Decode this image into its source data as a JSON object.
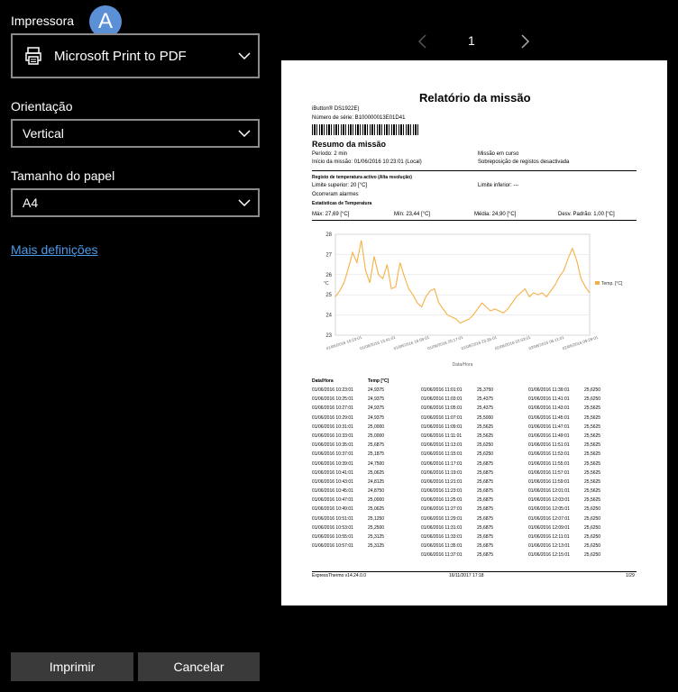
{
  "left": {
    "printer_label": "Impressora",
    "printer_value": "Microsoft Print to PDF",
    "badge": "A",
    "orientation_label": "Orientação",
    "orientation_value": "Vertical",
    "paper_label": "Tamanho do papel",
    "paper_value": "A4",
    "more_settings": "Mais definições",
    "print_button": "Imprimir",
    "cancel_button": "Cancelar"
  },
  "pager": {
    "page": "1"
  },
  "report": {
    "title": "Relatório da missão",
    "device": "iButton® DS1922E)",
    "serial": "Número de série: B100000013E01D41",
    "summary_title": "Resumo da missão",
    "period": "Período: 2 min",
    "start": "Início da missão: 01/06/2016 10:23:01 (Local)",
    "status": "Missão em curso",
    "overwrite": "Sobreposição de registos desactivada",
    "temp_reg": "Registo de temperatura activo (Alta resolução)",
    "upper_limit": "Limite superior: 20 [°C]",
    "lower_limit": "Limite inferior: ---",
    "alarms": "Ocorreram alarmes",
    "stats_title": "Estatísticas de Temperatura",
    "max": "Máx: 27,69 [°C]",
    "min": "Mín: 23,44 [°C]",
    "avg": "Média: 24,90 [°C]",
    "std": "Desv. Padrão: 1,00 [°C]",
    "table_headers": {
      "date": "Data/Hora",
      "temp": "Temp [°C]"
    },
    "footer_left": "ExpressThermo v14.24.0.0",
    "footer_mid": "16/11/2017    17:18",
    "footer_right": "1/29"
  },
  "chart_data": {
    "type": "line",
    "ylabel": "°C",
    "xlabel": "Data/Hora",
    "ylim": [
      23,
      28
    ],
    "yticks": [
      23,
      24,
      25,
      26,
      27,
      28
    ],
    "grid": true,
    "legend": "right",
    "series": [
      {
        "name": "Temp. [°C]",
        "color": "#f5b042",
        "values": [
          24.9,
          25.2,
          25.6,
          26.3,
          27.1,
          26.6,
          27.7,
          26.2,
          25.6,
          26.9,
          26.0,
          25.8,
          26.5,
          25.3,
          25.4,
          26.6,
          25.9,
          25.3,
          25.0,
          24.6,
          24.4,
          24.9,
          25.2,
          25.3,
          24.6,
          24.3,
          24.0,
          23.9,
          23.8,
          23.6,
          23.7,
          23.8,
          24.0,
          24.3,
          24.6,
          24.4,
          24.2,
          24.3,
          24.2,
          24.1,
          24.3,
          24.6,
          24.9,
          25.1,
          25.3,
          24.9,
          25.1,
          25.0,
          25.1,
          24.9,
          25.2,
          25.5,
          25.9,
          26.2,
          26.8,
          27.3,
          26.7,
          25.8,
          25.4,
          25.1
        ]
      }
    ],
    "xticks": [
      "01/06/2016 10:23:01",
      "01/06/2016 13:41:01",
      "01/06/2016 16:59:01",
      "01/06/2016 20:17:01",
      "01/06/2016 23:35:01",
      "02/06/2016 02:53:01",
      "02/06/2016 06:11:01",
      "02/06/2016 09:29:01"
    ]
  },
  "table": {
    "col1": [
      [
        "01/06/2016 10:23:01",
        "24,9375"
      ],
      [
        "01/06/2016 10:25:01",
        "24,9375"
      ],
      [
        "01/06/2016 10:27:01",
        "24,9375"
      ],
      [
        "01/06/2016 10:29:01",
        "24,9375"
      ],
      [
        "01/06/2016 10:31:01",
        "25,0000"
      ],
      [
        "01/06/2016 10:33:01",
        "25,0000"
      ],
      [
        "01/06/2016 10:35:01",
        "25,6875"
      ],
      [
        "01/06/2016 10:37:01",
        "25,1875"
      ],
      [
        "01/06/2016 10:39:01",
        "24,7500"
      ],
      [
        "01/06/2016 10:41:01",
        "25,0625"
      ],
      [
        "01/06/2016 10:43:01",
        "24,8125"
      ],
      [
        "01/06/2016 10:45:01",
        "24,8750"
      ],
      [
        "01/06/2016 10:47:01",
        "25,0000"
      ],
      [
        "01/06/2016 10:49:01",
        "25,0625"
      ],
      [
        "01/06/2016 10:51:01",
        "25,1250"
      ],
      [
        "01/06/2016 10:53:01",
        "25,2500"
      ],
      [
        "01/06/2016 10:55:01",
        "25,3125"
      ],
      [
        "01/06/2016 10:57:01",
        "25,3125"
      ]
    ],
    "col2": [
      [
        "01/06/2016 11:01:01",
        "25,3750"
      ],
      [
        "01/06/2016 11:03:01",
        "25,4375"
      ],
      [
        "01/06/2016 11:05:01",
        "25,4375"
      ],
      [
        "01/06/2016 11:07:01",
        "25,5000"
      ],
      [
        "01/06/2016 11:09:01",
        "25,5625"
      ],
      [
        "01/06/2016 11:11:01",
        "25,5625"
      ],
      [
        "01/06/2016 11:13:01",
        "25,6250"
      ],
      [
        "01/06/2016 11:15:01",
        "25,6250"
      ],
      [
        "01/06/2016 11:17:01",
        "25,6875"
      ],
      [
        "01/06/2016 11:19:01",
        "25,6875"
      ],
      [
        "01/06/2016 11:21:01",
        "25,6875"
      ],
      [
        "01/06/2016 11:23:01",
        "25,6875"
      ],
      [
        "01/06/2016 11:25:01",
        "25,6875"
      ],
      [
        "01/06/2016 11:27:01",
        "25,6875"
      ],
      [
        "01/06/2016 11:29:01",
        "25,6875"
      ],
      [
        "01/06/2016 11:31:01",
        "25,6875"
      ],
      [
        "01/06/2016 11:33:01",
        "25,6875"
      ],
      [
        "01/06/2016 11:35:01",
        "25,6875"
      ],
      [
        "01/06/2016 11:37:01",
        "25,6875"
      ]
    ],
    "col3": [
      [
        "01/06/2016 11:39:01",
        "25,6250"
      ],
      [
        "01/06/2016 11:41:01",
        "25,6250"
      ],
      [
        "01/06/2016 11:43:01",
        "25,5625"
      ],
      [
        "01/06/2016 11:45:01",
        "25,5625"
      ],
      [
        "01/06/2016 11:47:01",
        "25,5625"
      ],
      [
        "01/06/2016 11:49:01",
        "25,5625"
      ],
      [
        "01/06/2016 11:51:01",
        "25,5625"
      ],
      [
        "01/06/2016 11:53:01",
        "25,5625"
      ],
      [
        "01/06/2016 11:55:01",
        "25,5625"
      ],
      [
        "01/06/2016 11:57:01",
        "25,5625"
      ],
      [
        "01/06/2016 11:59:01",
        "25,5625"
      ],
      [
        "01/06/2016 12:01:01",
        "25,5625"
      ],
      [
        "01/06/2016 12:03:01",
        "25,5625"
      ],
      [
        "01/06/2016 12:05:01",
        "25,6250"
      ],
      [
        "01/06/2016 12:07:01",
        "25,6250"
      ],
      [
        "01/06/2016 12:09:01",
        "25,6250"
      ],
      [
        "01/06/2016 12:11:01",
        "25,6250"
      ],
      [
        "01/06/2016 12:13:01",
        "25,6250"
      ],
      [
        "01/06/2016 12:15:01",
        "25,6250"
      ]
    ]
  }
}
